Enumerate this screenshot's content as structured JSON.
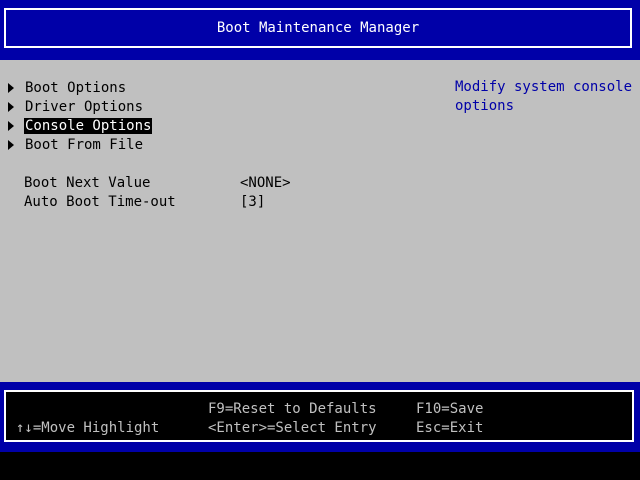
{
  "header": {
    "title": "Boot Maintenance Manager"
  },
  "menu": {
    "items": [
      {
        "label": "Boot Options",
        "selected": false
      },
      {
        "label": "Driver Options",
        "selected": false
      },
      {
        "label": "Console Options",
        "selected": true
      },
      {
        "label": "Boot From File",
        "selected": false
      }
    ]
  },
  "fields": [
    {
      "label": "Boot Next Value",
      "value": "<NONE>"
    },
    {
      "label": "Auto Boot Time-out",
      "value": "[3]"
    }
  ],
  "help": {
    "text": "Modify system console options"
  },
  "footer": {
    "move_highlight": "↑↓=Move Highlight",
    "reset_defaults": "F9=Reset to Defaults",
    "select_entry": "<Enter>=Select Entry",
    "save": "F10=Save",
    "exit": "Esc=Exit"
  },
  "colors": {
    "header_bg": "#0000a8",
    "body_bg": "#c0c0c0",
    "help_text": "#0000a8",
    "selected_bg": "#000000",
    "selected_text": "#ffffff",
    "footer_bg": "#000000"
  }
}
